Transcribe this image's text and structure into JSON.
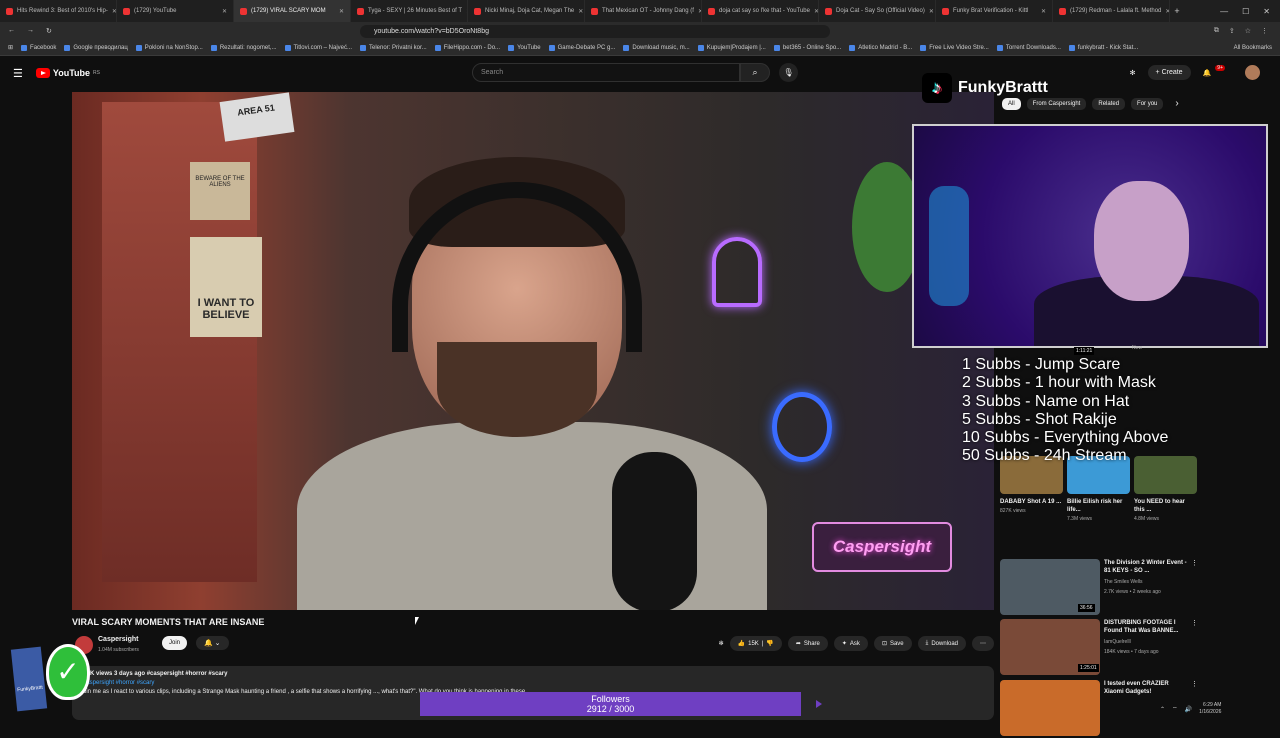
{
  "browser": {
    "tabs": [
      {
        "label": "Hits Rewind 3: Best of 2010's Hip-",
        "active": false
      },
      {
        "label": "(1729) YouTube",
        "active": false
      },
      {
        "label": "(1729) VIRAL SCARY MOM",
        "active": true
      },
      {
        "label": "Tyga - SEXY | 26 Minutes Best of T",
        "active": false
      },
      {
        "label": "Nicki Minaj, Doja Cat, Megan The",
        "active": false
      },
      {
        "label": "That Mexican OT - Johnny Dang (f",
        "active": false
      },
      {
        "label": "doja cat say so l'ke that - YouTube",
        "active": false
      },
      {
        "label": "Doja Cat - Say So (Official Video)",
        "active": false
      },
      {
        "label": "Funky Brat Verification - Kittl",
        "active": false
      },
      {
        "label": "(1729) Redman - Lalala ft. Method",
        "active": false
      }
    ],
    "url": "youtube.com/watch?v=bD5OroNt8bg",
    "bookmarks": [
      "Facebook",
      "Google преводилац",
      "Pokloni na NonStop...",
      "Rezultati: nogomet,...",
      "Titlovi.com – Najveć...",
      "Telenor: Privatni kor...",
      "FileHippo.com - Do...",
      "YouTube",
      "Game-Debate PC g...",
      "Download music, m...",
      "Kupujem|Prodajem |...",
      "bet365 - Online Spo...",
      "Atletico Madrid - B...",
      "Free Live Video Stre...",
      "Torrent Downloads...",
      "funkybratt - Kick Stat..."
    ],
    "all_bookmarks": "All Bookmarks"
  },
  "youtube": {
    "logo": "YouTube",
    "region": "RS",
    "search_placeholder": "Search",
    "create_label": "Create",
    "notif_count": "9+"
  },
  "video": {
    "title": "VIRAL SCARY MOMENTS THAT ARE INSANE",
    "channel": "Caspersight",
    "subscribers": "1.04M subscribers",
    "join": "Join",
    "likes": "15K",
    "share": "Share",
    "ask": "Ask",
    "save": "Save",
    "download": "Download",
    "meta": "186K views  3 days ago  #caspersight #horror #scary",
    "tags": "#caspersight #horror #scary",
    "description": "Join me as I react to various clips, including a Strange Mask haunting a friend , a selfie that shows a horrifying ..., what's that?\". What do you think is happening in these",
    "sign": "Caspersight",
    "poster_believe": "I WANT TO BELIEVE",
    "poster_aliens": "BEWARE OF THE ALIENS",
    "area51": "AREA 51"
  },
  "sidebar": {
    "chips": [
      "All",
      "From Caspersight",
      "Related",
      "For you"
    ],
    "cam_duration": "1:11:21",
    "new_label": "New",
    "shorts": [
      {
        "title": "DABABY Shot A 19 ...",
        "views": "827K views",
        "color": "#8a6b3a"
      },
      {
        "title": "Billie Eilish risk her life...",
        "views": "7.3M views",
        "color": "#3c9ad6"
      },
      {
        "title": "You NEED to hear this ...",
        "views": "4.8M views",
        "color": "#4a5f33"
      }
    ],
    "videos": [
      {
        "title": "The Division 2 Winter Event - 81 KEYS - SO ...",
        "channel": "The Smiles Wells",
        "views": "2.7K views • 2 weeks ago",
        "duration": "36:56",
        "color": "#4e5a63"
      },
      {
        "title": "DISTURBING FOOTAGE I Found That Was BANNE...",
        "channel": "IamQuelrelll",
        "views": "184K views • 7 days ago",
        "duration": "1:25:01",
        "color": "#7a4a38"
      },
      {
        "title": "I tested even CRAZIER Xiaomi Gadgets!",
        "channel": "",
        "views": "",
        "duration": "",
        "color": "#c96b2a"
      }
    ]
  },
  "stream_overlay": {
    "brand": "FunkyBrattt",
    "sub_goals": [
      "1 Subbs - Jump Scare",
      "2 Subbs - 1 hour with Mask",
      "3 Subbs - Name on Hat",
      "5 Subbs - Shot Rakije",
      "10 Subbs - Everything Above",
      "50 Subbs - 24h Stream"
    ],
    "followers_label": "Followers",
    "followers_progress": "2912 / 3000",
    "followers_current": 2912,
    "followers_goal": 3000
  },
  "taskbar": {
    "time": "6:29 AM",
    "date": "1/16/2026"
  }
}
